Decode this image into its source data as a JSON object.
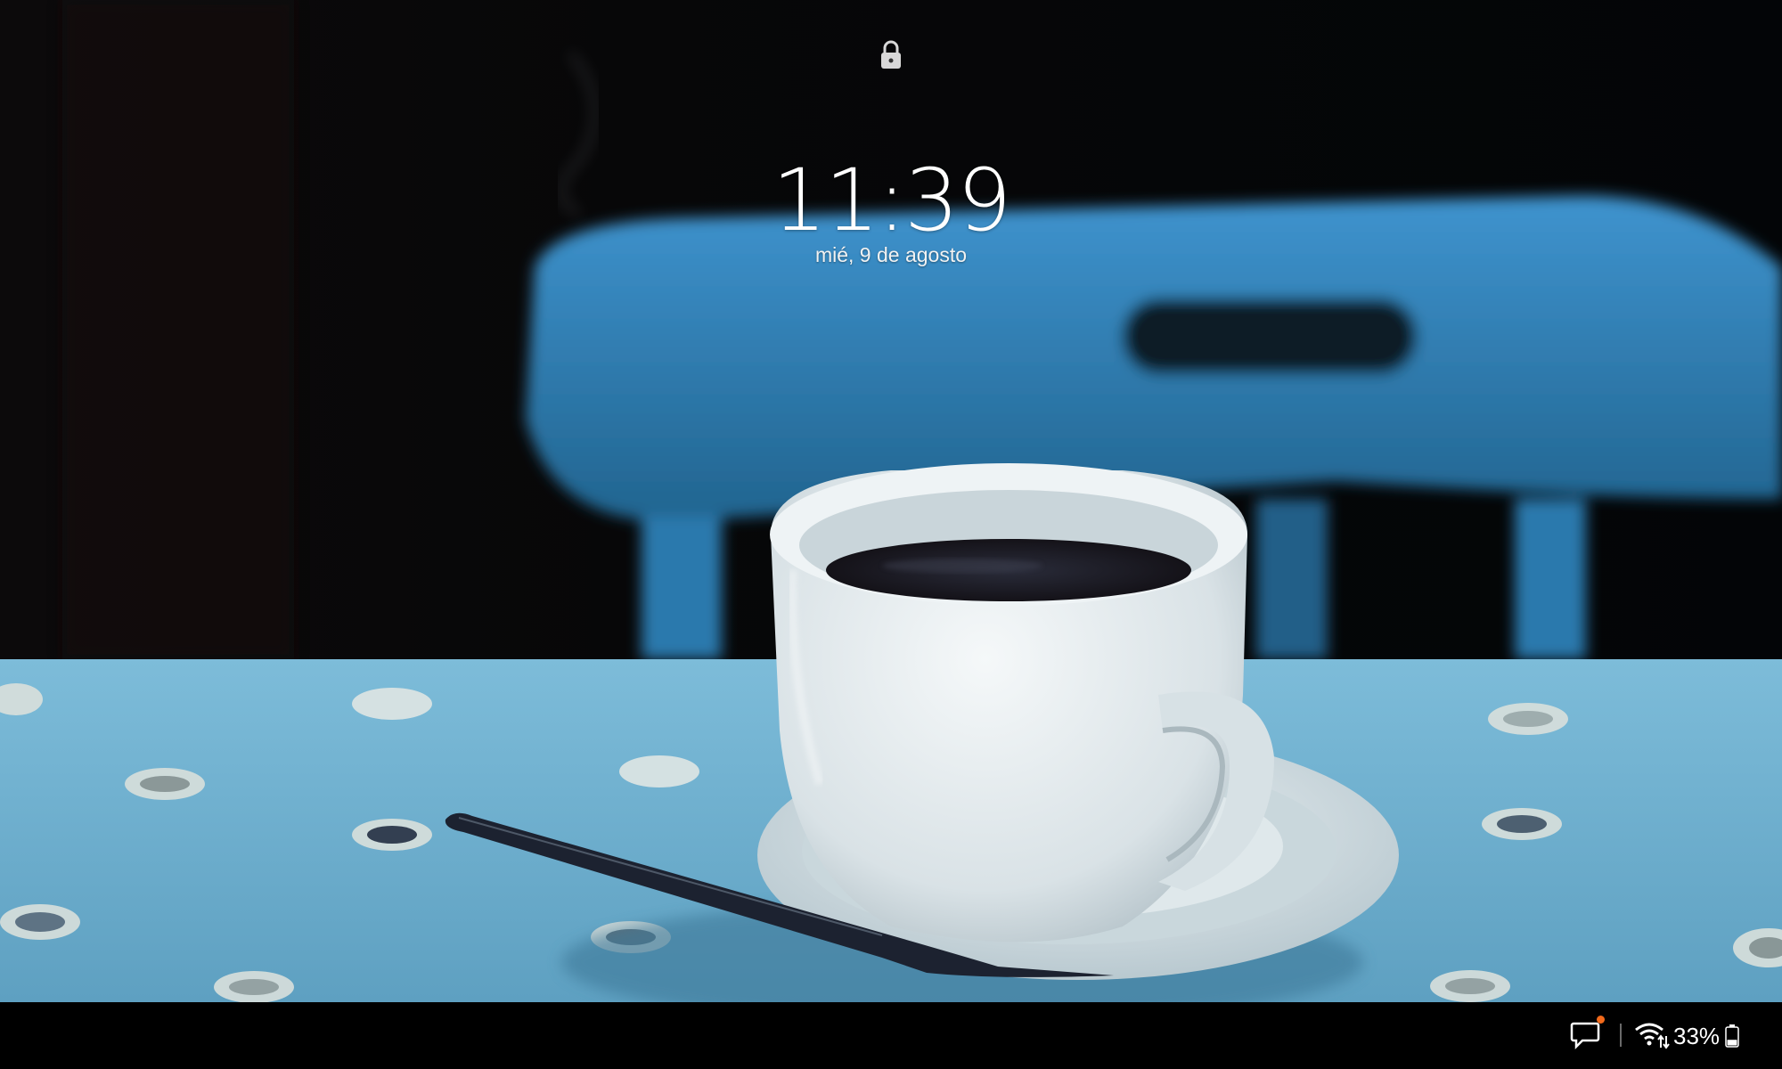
{
  "lockscreen": {
    "lock_icon": "lock-icon",
    "time": "11:39",
    "date": "mié, 9 de agosto"
  },
  "wallpaper": {
    "subject": "coffee-cup-wallpaper",
    "colors": {
      "background": "#07090d",
      "chair": "#2f7fb8",
      "tablecloth": "#6aaecf",
      "cup": "#e9eef0",
      "coffee": "#1b1a22"
    }
  },
  "status_bar": {
    "notification_icon": "message-notification-icon",
    "notification_dot_color": "#f26a1b",
    "wifi_icon": "wifi-data-icon",
    "battery_percent": "33%",
    "battery_icon": "battery-icon",
    "battery_level": 0.33
  }
}
